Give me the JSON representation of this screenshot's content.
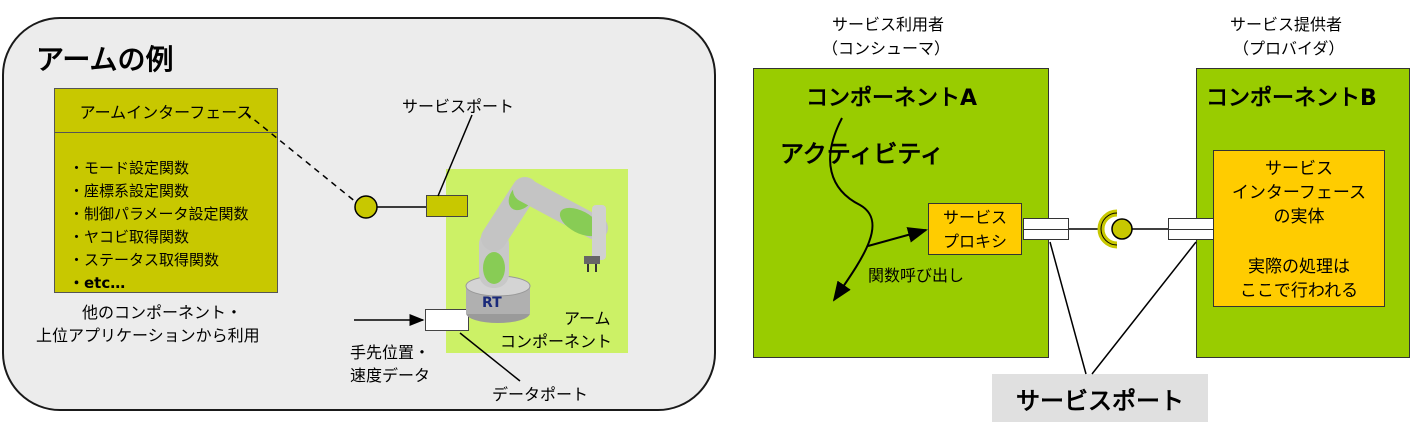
{
  "left": {
    "title": "アームの例",
    "interface_title": "アームインターフェース",
    "methods": [
      "・モード設定関数",
      "・座標系設定関数",
      "・制御パラメータ設定関数",
      "・ヤコビ取得関数",
      "・ステータス取得関数",
      "・etc…"
    ],
    "usage_line1": "他のコンポーネント・",
    "usage_line2": "上位アプリケーションから利用",
    "service_port_label": "サービスポート",
    "arm_component_line1": "アーム",
    "arm_component_line2": "コンポーネント",
    "rt_logo": "RT",
    "data_input_line1": "手先位置・",
    "data_input_line2": "速度データ",
    "data_port_label": "データポート"
  },
  "right": {
    "consumer_line1": "サービス利用者",
    "consumer_line2": "（コンシューマ）",
    "provider_line1": "サービス提供者",
    "provider_line2": "（プロバイダ）",
    "component_a": "コンポーネントA",
    "component_b": "コンポーネントB",
    "activity": "アクティビティ",
    "proxy_line1": "サービス",
    "proxy_line2": "プロキシ",
    "function_call": "関数呼び出し",
    "impl_line1": "サービス",
    "impl_line2": "インターフェース",
    "impl_line3": "の実体",
    "impl_line4": "実際の処理は",
    "impl_line5": "ここで行われる",
    "service_port": "サービスポート"
  },
  "colors": {
    "olive": "#c8c800",
    "green": "#99cc00",
    "lightgreen": "#ccf166",
    "yellow": "#ffcc00",
    "panel": "#ececec"
  }
}
